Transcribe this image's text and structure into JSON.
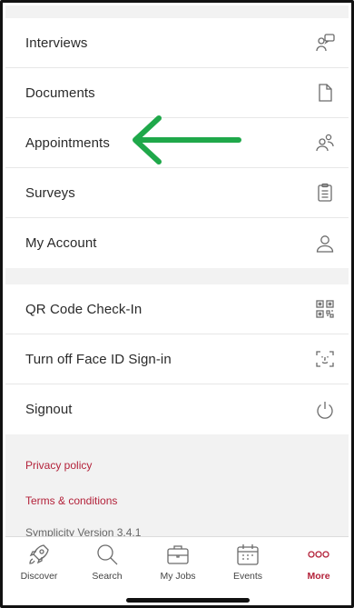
{
  "menu_group_1": [
    {
      "label": "Interviews",
      "icon": "interview-chat-icon"
    },
    {
      "label": "Documents",
      "icon": "document-icon"
    },
    {
      "label": "Appointments",
      "icon": "people-icon"
    },
    {
      "label": "Surveys",
      "icon": "clipboard-icon"
    },
    {
      "label": "My Account",
      "icon": "person-icon"
    }
  ],
  "menu_group_2": [
    {
      "label": "QR Code Check-In",
      "icon": "qr-code-icon"
    },
    {
      "label": "Turn off Face ID Sign-in",
      "icon": "face-id-icon"
    },
    {
      "label": "Signout",
      "icon": "power-icon"
    }
  ],
  "footer": {
    "privacy": "Privacy policy",
    "terms": "Terms & conditions",
    "version": "Symplicity Version 3.4.1"
  },
  "tabbar": [
    {
      "label": "Discover",
      "icon": "rocket-icon",
      "active": false
    },
    {
      "label": "Search",
      "icon": "search-icon",
      "active": false
    },
    {
      "label": "My Jobs",
      "icon": "briefcase-icon",
      "active": false
    },
    {
      "label": "Events",
      "icon": "calendar-icon",
      "active": false
    },
    {
      "label": "More",
      "icon": "more-dots-icon",
      "active": true
    }
  ],
  "colors": {
    "accent": "#b3223a",
    "annotation_arrow": "#1fa84a",
    "section_gap": "#f2f2f2"
  }
}
